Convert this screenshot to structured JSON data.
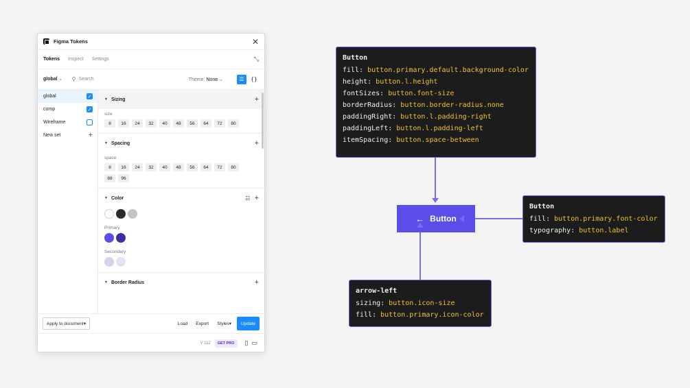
{
  "plugin": {
    "title": "Figma Tokens",
    "tabs": [
      {
        "label": "Tokens",
        "active": true
      },
      {
        "label": "Inspect",
        "active": false
      },
      {
        "label": "Settings",
        "active": false
      }
    ],
    "toolbar": {
      "set_select": "global",
      "search_placeholder": "Search",
      "theme_label": "Theme:",
      "theme_value": "None"
    },
    "sets": [
      {
        "label": "global",
        "checked": true,
        "active": true
      },
      {
        "label": "comp",
        "checked": true,
        "active": false
      },
      {
        "label": "Wireframe",
        "checked": false,
        "active": false
      },
      {
        "label": "New set",
        "is_add": true
      }
    ],
    "groups": {
      "sizing": {
        "title": "Sizing",
        "sub": "size",
        "chips": [
          "8",
          "16",
          "24",
          "32",
          "40",
          "48",
          "56",
          "64",
          "72",
          "80"
        ]
      },
      "spacing": {
        "title": "Spacing",
        "sub": "space",
        "chips": [
          "8",
          "16",
          "24",
          "32",
          "40",
          "48",
          "56",
          "64",
          "72",
          "80",
          "88",
          "96"
        ]
      },
      "color": {
        "title": "Color",
        "base": [
          "#ffffff",
          "#2b2b2b",
          "#c4c4c8"
        ],
        "primary_label": "Primary",
        "primary": [
          "#5b4dea",
          "#3b2f9e"
        ],
        "secondary_label": "Secondary",
        "secondary": [
          "#d5d3ec",
          "#e4e2f2"
        ]
      },
      "border_radius": {
        "title": "Border Radius"
      }
    },
    "footer": {
      "apply": "Apply to document",
      "load": "Load",
      "export": "Export",
      "styles": "Styles",
      "update": "Update",
      "version": "V 112",
      "pro": "GET PRO"
    }
  },
  "diagram": {
    "button_box": {
      "name": "Button",
      "lines": [
        {
          "key": "fill: ",
          "val": "button.primary.default.background-color"
        },
        {
          "key": "height: ",
          "val": "button.l.height"
        },
        {
          "key": "fontSizes: ",
          "val": "button.font-size"
        },
        {
          "key": "borderRadius: ",
          "val": "button.border-radius.none"
        },
        {
          "key": "paddingRight: ",
          "val": "button.l.padding-right"
        },
        {
          "key": "paddingLeft: ",
          "val": "button.l.padding-left"
        },
        {
          "key": "itemSpacing: ",
          "val": "button.space-between"
        }
      ]
    },
    "label_box": {
      "name": "Button",
      "lines": [
        {
          "key": "fill: ",
          "val": "button.primary.font-color"
        },
        {
          "key": "typography: ",
          "val": "button.label"
        }
      ]
    },
    "icon_box": {
      "name": "arrow-left",
      "lines": [
        {
          "key": "sizing: ",
          "val": "button.icon-size"
        },
        {
          "key": "fill: ",
          "val": "button.primary.icon-color"
        }
      ]
    },
    "demo_button": {
      "label": "Button",
      "color": "#5b4dea"
    },
    "accent_color": "#7a6cf0"
  }
}
